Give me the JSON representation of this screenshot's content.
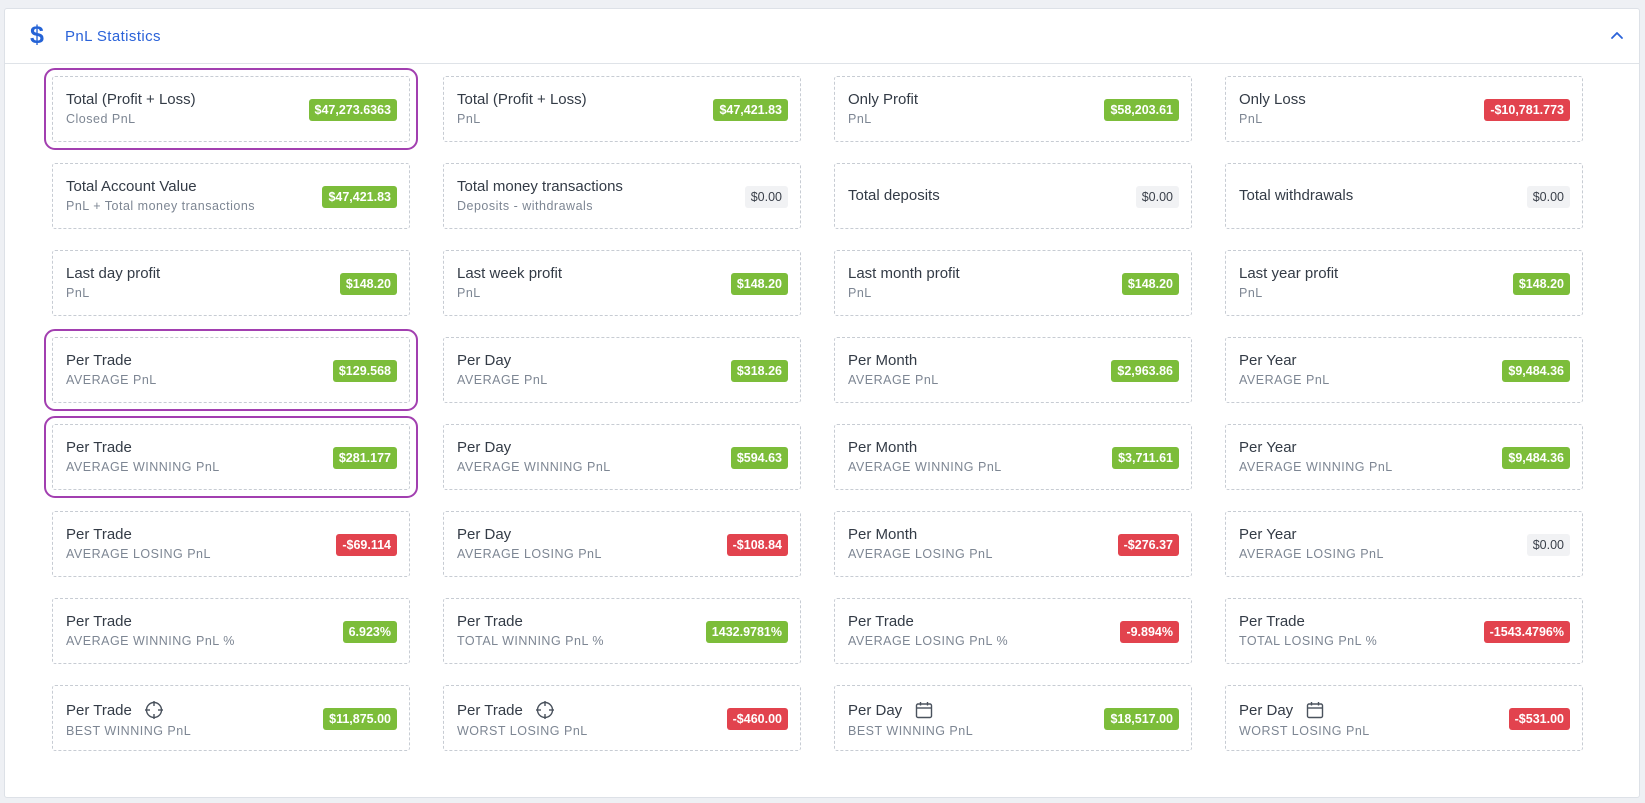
{
  "header": {
    "title": "PnL Statistics"
  },
  "icons": {
    "header": "dollar-icon",
    "collapse": "chevron-up-icon",
    "trade": "crosshair-icon",
    "day": "calendar-icon"
  },
  "colors": {
    "accent": "#2b63d9",
    "positive": "#7cbd3a",
    "negative": "#e2434e",
    "highlight": "#a23fb0"
  },
  "cards": [
    {
      "title": "Total (Profit + Loss)",
      "subtitle": "Closed PnL",
      "value": "$47,273.6363",
      "status": "positive",
      "highlight": true
    },
    {
      "title": "Total (Profit + Loss)",
      "subtitle": "PnL",
      "value": "$47,421.83",
      "status": "positive"
    },
    {
      "title": "Only Profit",
      "subtitle": "PnL",
      "value": "$58,203.61",
      "status": "positive"
    },
    {
      "title": "Only Loss",
      "subtitle": "PnL",
      "value": "-$10,781.773",
      "status": "negative"
    },
    {
      "title": "Total Account Value",
      "subtitle": "PnL + Total money transactions",
      "value": "$47,421.83",
      "status": "positive"
    },
    {
      "title": "Total money transactions",
      "subtitle": "Deposits - withdrawals",
      "value": "$0.00",
      "status": "neutral"
    },
    {
      "title": "Total deposits",
      "subtitle": "",
      "value": "$0.00",
      "status": "neutral"
    },
    {
      "title": "Total withdrawals",
      "subtitle": "",
      "value": "$0.00",
      "status": "neutral"
    },
    {
      "title": "Last day profit",
      "subtitle": "PnL",
      "value": "$148.20",
      "status": "positive"
    },
    {
      "title": "Last week profit",
      "subtitle": "PnL",
      "value": "$148.20",
      "status": "positive"
    },
    {
      "title": "Last month profit",
      "subtitle": "PnL",
      "value": "$148.20",
      "status": "positive"
    },
    {
      "title": "Last year profit",
      "subtitle": "PnL",
      "value": "$148.20",
      "status": "positive"
    },
    {
      "title": "Per Trade",
      "subtitle": "AVERAGE PnL",
      "value": "$129.568",
      "status": "positive",
      "highlight": true
    },
    {
      "title": "Per Day",
      "subtitle": "AVERAGE PnL",
      "value": "$318.26",
      "status": "positive"
    },
    {
      "title": "Per Month",
      "subtitle": "AVERAGE PnL",
      "value": "$2,963.86",
      "status": "positive"
    },
    {
      "title": "Per Year",
      "subtitle": "AVERAGE PnL",
      "value": "$9,484.36",
      "status": "positive"
    },
    {
      "title": "Per Trade",
      "subtitle": "AVERAGE WINNING PnL",
      "value": "$281.177",
      "status": "positive",
      "highlight": true
    },
    {
      "title": "Per Day",
      "subtitle": "AVERAGE WINNING PnL",
      "value": "$594.63",
      "status": "positive"
    },
    {
      "title": "Per Month",
      "subtitle": "AVERAGE WINNING PnL",
      "value": "$3,711.61",
      "status": "positive"
    },
    {
      "title": "Per Year",
      "subtitle": "AVERAGE WINNING PnL",
      "value": "$9,484.36",
      "status": "positive"
    },
    {
      "title": "Per Trade",
      "subtitle": "AVERAGE LOSING PnL",
      "value": "-$69.114",
      "status": "negative"
    },
    {
      "title": "Per Day",
      "subtitle": "AVERAGE LOSING PnL",
      "value": "-$108.84",
      "status": "negative"
    },
    {
      "title": "Per Month",
      "subtitle": "AVERAGE LOSING PnL",
      "value": "-$276.37",
      "status": "negative"
    },
    {
      "title": "Per Year",
      "subtitle": "AVERAGE LOSING PnL",
      "value": "$0.00",
      "status": "neutral"
    },
    {
      "title": "Per Trade",
      "subtitle": "AVERAGE WINNING PnL %",
      "value": "6.923%",
      "status": "positive"
    },
    {
      "title": "Per Trade",
      "subtitle": "TOTAL WINNING PnL %",
      "value": "1432.9781%",
      "status": "positive"
    },
    {
      "title": "Per Trade",
      "subtitle": "AVERAGE LOSING PnL %",
      "value": "-9.894%",
      "status": "negative"
    },
    {
      "title": "Per Trade",
      "subtitle": "TOTAL LOSING PnL %",
      "value": "-1543.4796%",
      "status": "negative"
    },
    {
      "title": "Per Trade",
      "subtitle": "BEST WINNING PnL",
      "value": "$11,875.00",
      "status": "positive",
      "icon": "crosshair-icon"
    },
    {
      "title": "Per Trade",
      "subtitle": "WORST LOSING PnL",
      "value": "-$460.00",
      "status": "negative",
      "icon": "crosshair-icon"
    },
    {
      "title": "Per Day",
      "subtitle": "BEST WINNING PnL",
      "value": "$18,517.00",
      "status": "positive",
      "icon": "calendar-icon"
    },
    {
      "title": "Per Day",
      "subtitle": "WORST LOSING PnL",
      "value": "-$531.00",
      "status": "negative",
      "icon": "calendar-icon"
    }
  ]
}
